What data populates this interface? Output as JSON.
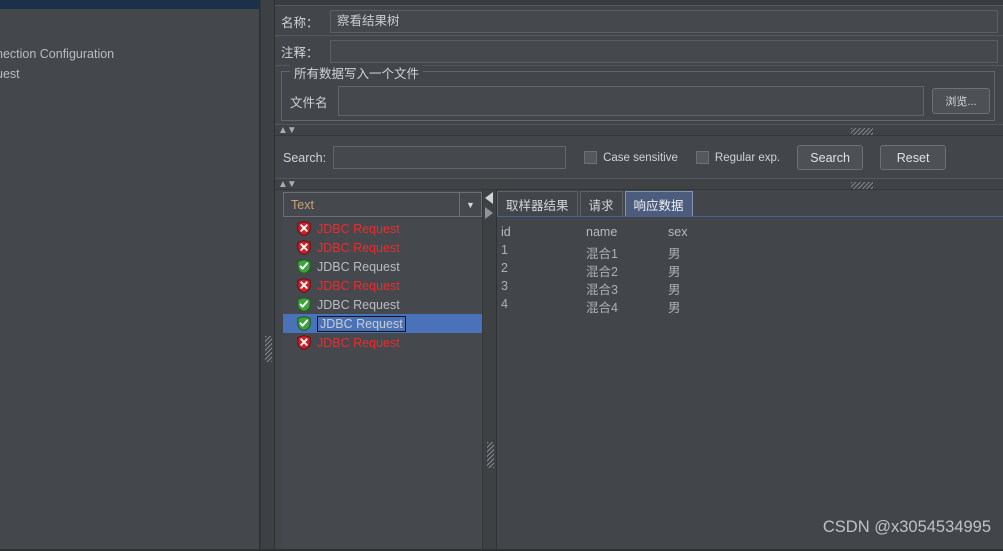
{
  "sidebar": {
    "tree_lines": [
      "nection Configuration",
      "uest"
    ]
  },
  "main": {
    "name_row": {
      "label": "名称：",
      "value": "察看结果树"
    },
    "comment_row": {
      "label": "注释：",
      "value": ""
    },
    "file_group": {
      "title": "所有数据写入一个文件",
      "filename_label": "文件名",
      "filename_value": "",
      "filename_placeholder": "",
      "browse_label": "浏览..."
    },
    "search": {
      "label": "Search:",
      "value": "",
      "placeholder": "",
      "case_sensitive_label": "Case sensitive",
      "case_sensitive_checked": false,
      "regular_exp_label": "Regular exp.",
      "regular_exp_checked": false,
      "search_button": "Search",
      "reset_button": "Reset"
    },
    "collapse_arrows": "▲▼"
  },
  "tree": {
    "combo_value": "Text",
    "items": [
      {
        "label": "JDBC Request",
        "status": "error",
        "selected": false
      },
      {
        "label": "JDBC Request",
        "status": "error",
        "selected": false
      },
      {
        "label": "JDBC Request",
        "status": "success",
        "selected": false
      },
      {
        "label": "JDBC Request",
        "status": "error",
        "selected": false
      },
      {
        "label": "JDBC Request",
        "status": "success",
        "selected": false
      },
      {
        "label": "JDBC Request",
        "status": "success",
        "selected": true
      },
      {
        "label": "JDBC Request",
        "status": "error",
        "selected": false
      }
    ]
  },
  "detail": {
    "tabs": [
      {
        "label": "取样器结果",
        "active": false
      },
      {
        "label": "请求",
        "active": false
      },
      {
        "label": "响应数据",
        "active": true
      }
    ],
    "table": {
      "headers": [
        "id",
        "name",
        "sex"
      ],
      "rows": [
        [
          "1",
          "混合1",
          "男"
        ],
        [
          "2",
          "混合2",
          "男"
        ],
        [
          "3",
          "混合3",
          "男"
        ],
        [
          "4",
          "混合4",
          "男"
        ]
      ]
    }
  },
  "watermark": {
    "text": "CSDN @x3054534995"
  },
  "colors": {
    "panel_bg": "#42464a",
    "sidebar_bg": "#44484c",
    "title_bar_blue": "#1b3049",
    "selection_blue": "#4a72b8",
    "active_tab_blue": "#4c5c7c",
    "error_red": "#f0292c",
    "success_green": "#3fa23f",
    "combo_text_orange": "#c8a27a",
    "text_primary": "#d0d3d6",
    "text_secondary": "#aab0b5"
  }
}
